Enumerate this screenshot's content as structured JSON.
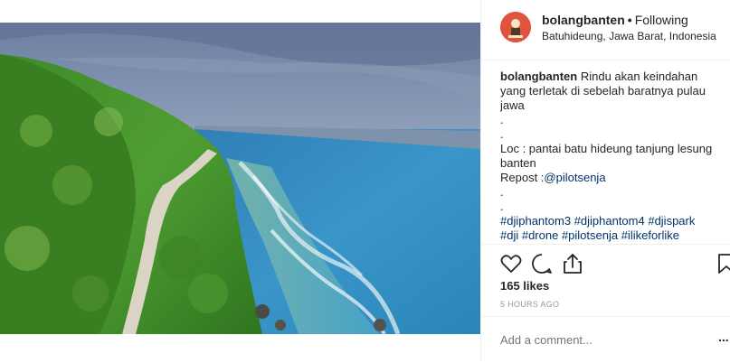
{
  "post": {
    "username": "bolangbanten",
    "separator": "•",
    "follow_status": "Following",
    "location": "Batuhideung, Jawa Barat, Indonesia",
    "caption": {
      "user": "bolangbanten",
      "line1": "Rindu akan keindahan",
      "line2": "yang terletak di sebelah baratnya pulau",
      "line3": "jawa",
      "dot1": ".",
      "dot2": ".",
      "loc_line1": "Loc : pantai batu hideung tanjung lesung",
      "loc_line2": "banten",
      "repost_label": "Repost :",
      "repost_handle": "@pilotsenja",
      "dot3": ".",
      "dot4": ".",
      "hashtags_line1": "#djiphantom3 #djiphantom4 #djispark",
      "hashtags_line2": "#dji #drone #pilotsenja #ilikeforlike"
    },
    "likes": "165 likes",
    "time_ago": "5 HOURS AGO",
    "comment_placeholder": "Add a comment...",
    "more_label": "..."
  },
  "icons": {
    "like": "heart-icon",
    "comment": "comment-icon",
    "share": "share-icon",
    "save": "bookmark-icon"
  },
  "colors": {
    "link": "#003569",
    "avatar_bg": "#e0533e",
    "text": "#262626",
    "muted": "#999999",
    "border": "#efefef"
  }
}
